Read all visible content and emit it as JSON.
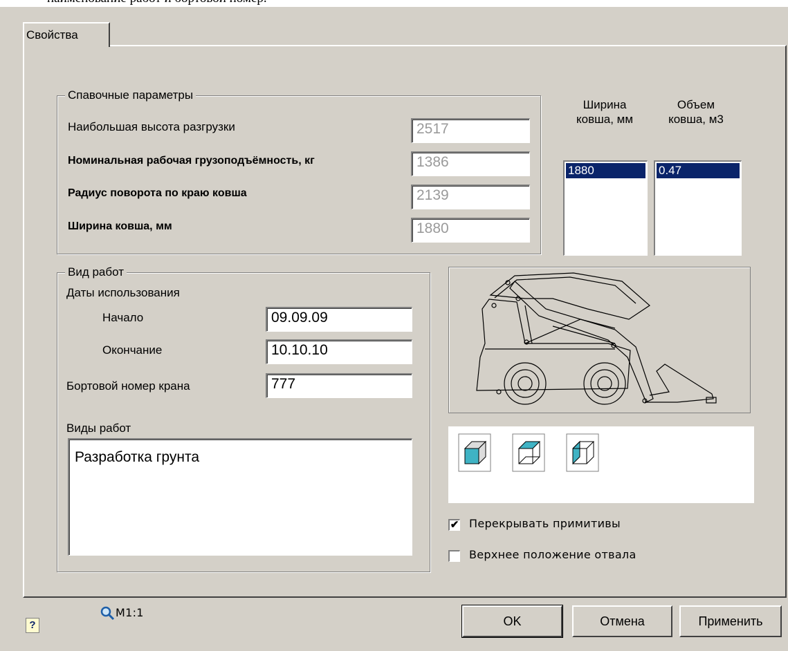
{
  "caption_fragment": "наименование работ и бортовой номер.",
  "tab": {
    "label": "Свойства"
  },
  "ref_params": {
    "legend": "Спавочные параметры",
    "rows": [
      {
        "label": "Наибольшая высота разгрузки",
        "value": "2517"
      },
      {
        "label": "Номинальная рабочая грузоподъёмность, кг",
        "value": "1386"
      },
      {
        "label": "Радиус поворота по краю ковша",
        "value": "2139"
      },
      {
        "label": "Ширина ковша, мм",
        "value": "1880"
      }
    ]
  },
  "bucket_lists": {
    "width_header": "Ширина\nковша, мм",
    "width_header_l1": "Ширина",
    "width_header_l2": "ковша, мм",
    "volume_header_l1": "Объем",
    "volume_header_l2": "ковша, м3",
    "width_items": [
      "1880"
    ],
    "volume_items": [
      "0.47"
    ]
  },
  "work": {
    "legend": "Вид работ",
    "dates_label": "Даты использования",
    "start_label": "Начало",
    "start_value": "09.09.09",
    "end_label": "Окончание",
    "end_value": "10.10.10",
    "board_label": "Бортовой номер крана",
    "board_value": "777",
    "types_label": "Виды работ",
    "types_value": "Разработка грунта"
  },
  "options": {
    "overlap_label": "Перекрывать примитивы",
    "overlap_checked": true,
    "blade_label": "Верхнее положение отвала",
    "blade_checked": false
  },
  "view_icons": [
    "shaded-cube-icon",
    "wire-top-cube-icon",
    "wire-side-cube-icon"
  ],
  "footer": {
    "scale": "M1:1",
    "ok": "OK",
    "cancel": "Отмена",
    "apply": "Применить"
  },
  "colors": {
    "selection": "#0a246a",
    "panel": "#d4d0c8",
    "cube_fill": "#3fb3c4"
  }
}
